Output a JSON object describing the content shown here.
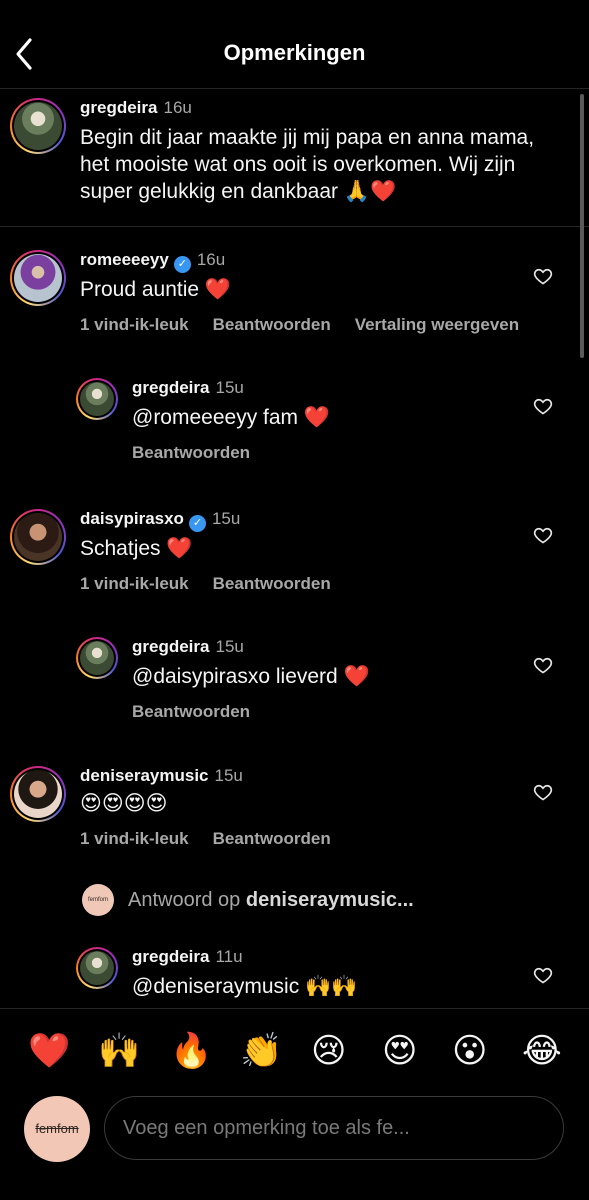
{
  "header": {
    "title": "Opmerkingen"
  },
  "caption": {
    "username": "gregdeira",
    "time": "16u",
    "text": "Begin dit jaar maakte jij mij papa en anna mama, het mooiste wat ons ooit is overkomen. Wij zijn super gelukkig en dankbaar 🙏❤️"
  },
  "comments": [
    {
      "username": "romeeeeyy",
      "verified": true,
      "time": "16u",
      "text": "Proud auntie ❤️",
      "likes": "1 vind-ik-leuk",
      "reply": "Beantwoorden",
      "translate": "Vertaling weergeven"
    },
    {
      "username": "gregdeira",
      "time": "15u",
      "text": "@romeeeeyy fam ❤️",
      "reply": "Beantwoorden"
    },
    {
      "username": "daisypirasxo",
      "verified": true,
      "time": "15u",
      "text": "Schatjes ❤️",
      "likes": "1 vind-ik-leuk",
      "reply": "Beantwoorden"
    },
    {
      "username": "gregdeira",
      "time": "15u",
      "text": "@daisypirasxo lieverd ❤️",
      "reply": "Beantwoorden"
    },
    {
      "username": "deniseraymusic",
      "time": "15u",
      "text": "😍😍😍😍",
      "likes": "1 vind-ik-leuk",
      "reply": "Beantwoorden"
    },
    {
      "username": "gregdeira",
      "time": "11u",
      "text": "@deniseraymusic 🙌🙌"
    }
  ],
  "replying": {
    "prefix": "Antwoord op",
    "target": "deniseraymusic...",
    "logo_text": "femfom"
  },
  "emoji_bar": [
    "❤️",
    "🙌",
    "🔥",
    "👏",
    "😢",
    "😍",
    "😮",
    "😂"
  ],
  "composer": {
    "avatar_text": "femfom",
    "placeholder": "Voeg een opmerking toe als fe..."
  },
  "colors": {
    "background": "#000000",
    "secondary_text": "#a8a8a8",
    "verified": "#3897f0",
    "heart": "#ed4956"
  }
}
